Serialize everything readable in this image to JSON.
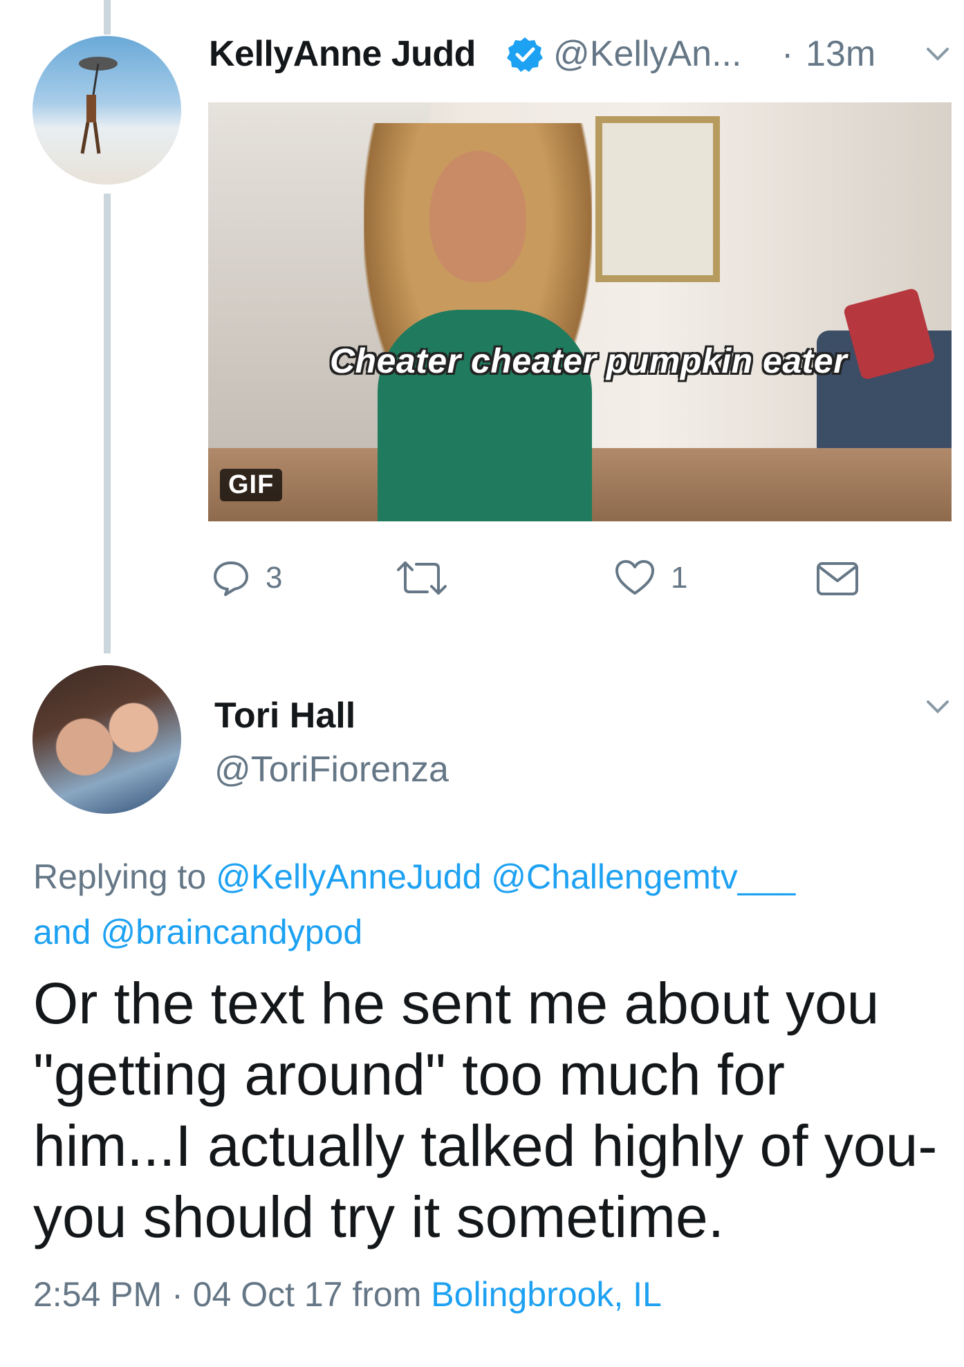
{
  "tweet": {
    "author_name": "KellyAnne Judd",
    "author_handle": "@KellyAn...",
    "separator": "·",
    "time": "13m",
    "gif_caption": "Cheater cheater pumpkin eater",
    "gif_badge": "GIF",
    "reply_count": "3",
    "like_count": "1"
  },
  "reply": {
    "author_name": "Tori Hall",
    "author_handle": "@ToriFiorenza",
    "replying_label": "Replying to",
    "mention_1": "@KellyAnneJudd",
    "mention_2": "@Challengemtv___",
    "and_label": "and",
    "mention_3": "@braincandypod",
    "text": "Or the text he sent me about you \"getting around\" too much for him...I actually talked highly of you- you should try it sometime.",
    "time": "2:54 PM",
    "separator": "·",
    "date": "04 Oct 17",
    "from_label": "from",
    "location": "Bolingbrook, IL"
  },
  "colors": {
    "accent": "#1da1f2",
    "secondary_text": "#657786",
    "thread_line": "#ccd6dd"
  }
}
